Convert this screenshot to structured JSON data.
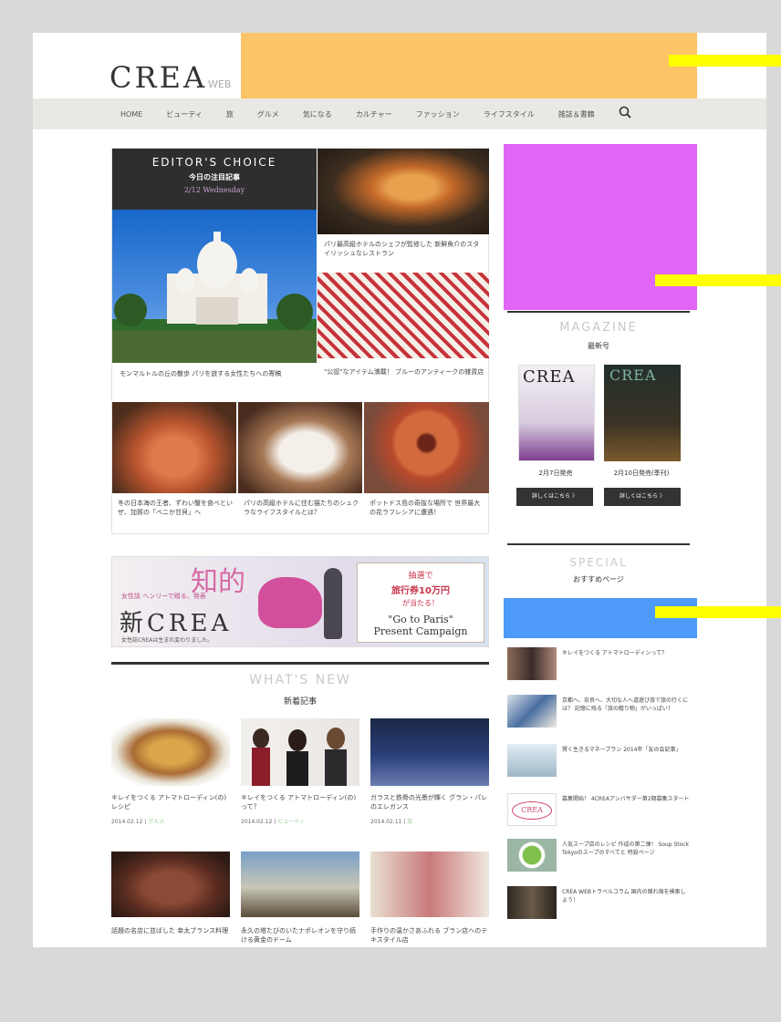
{
  "header": {
    "logo_main": "CREA",
    "logo_sub": "WEB",
    "ad_color": "#fcc466"
  },
  "nav": {
    "items": [
      "HOME",
      "ビューティ",
      "旅",
      "グルメ",
      "気になる",
      "カルチャー",
      "ファッション",
      "ライフスタイル",
      "雑誌＆書籍"
    ],
    "search_icon": "search-icon"
  },
  "editors_choice": {
    "title": "EDITOR'S CHOICE",
    "subtitle": "今日の注目記事",
    "date": "2/12 Wednesday",
    "captions": [
      "モンマルトルの丘の散歩 パリを旅する女性たちへの寄稿",
      "パリ最高級ホテルのシェフが監修した 新鮮魚介のスタイリッシュなレストラン",
      "\"公認\"なアイテム満載！ ブルーのアンティークの雑貨店",
      "冬の日本海の王者、ずわい蟹を食べといぜ、加賀の「ベニか甘貝」へ",
      "パリの高級ホテルに住む猫たちのシュクラなライフスタイルとは？",
      "ポットドス島の奇抜な場所で 世界最大の花ラフレシアに遭遇！"
    ]
  },
  "banner": {
    "headline": "知的",
    "tagline": "女性誌 ヘンリーで贈る、発表",
    "brand": "新CREA",
    "note": "女性誌CREAは生まれ変わりました。",
    "box_line1": "抽選で",
    "box_line2": "旅行券10万円",
    "box_line3": "が当たる！",
    "box_line4": "\"Go to Paris\"",
    "box_line5": "Present Campaign"
  },
  "whats_new": {
    "title": "WHAT'S NEW",
    "subtitle": "新着記事",
    "items": [
      {
        "caption": "キレイをつくる アトマトローディン(の) レシピ",
        "date": "2014.02.12",
        "tag": "グルメ"
      },
      {
        "caption": "キレイをつくる アトマトローディン(の) って？",
        "date": "2014.02.12",
        "tag": "ビューティ"
      },
      {
        "caption": "ガラスと鉄骨の光景が輝く グラン・パレのエレガンス",
        "date": "2014.02.11",
        "tag": "旅"
      },
      {
        "caption": "話題の名店に並ばした 幸太ブランス料理",
        "date": "",
        "tag": ""
      },
      {
        "caption": "永久の塔たびのいたナポレオンを守り続ける黄金のドーム",
        "date": "",
        "tag": ""
      },
      {
        "caption": "手作りの温かさあふれる ブラン店へのテキスタイル店",
        "date": "",
        "tag": ""
      }
    ]
  },
  "magazine": {
    "ad_color": "#e165f7",
    "title": "MAGAZINE",
    "subtitle": "最新号",
    "cover1_title": "CREA",
    "cover2_title": "CREA",
    "release1": "2月7日発売",
    "release2": "2月10日発売(季刊)",
    "button_label": "詳しくはこちら 〉"
  },
  "special": {
    "title": "SPECIAL",
    "subtitle": "おすすめページ",
    "ad_color": "#4d9af8",
    "items": [
      "キレイをつくる アトマトローディンって？",
      "京都へ、奈良へ、大切な人へ道遊び旅で旅の行くには？ 記憶に残る「旅の贈り物」がいっぱい！",
      "賢く生きるマネープラン 2014年「友の会記事」",
      "募集開始！ 4CREAアンバサダー第2期募集スタート",
      "人気スープ店のレシピ 作成の第二弾！ Soup Stock Tokyoのスープのすべてと 特設ページ",
      "CREA WEBトラベルコラム 国内の隠れ宿を検索しよう！"
    ]
  },
  "markers": {
    "color": "#ffff00"
  }
}
